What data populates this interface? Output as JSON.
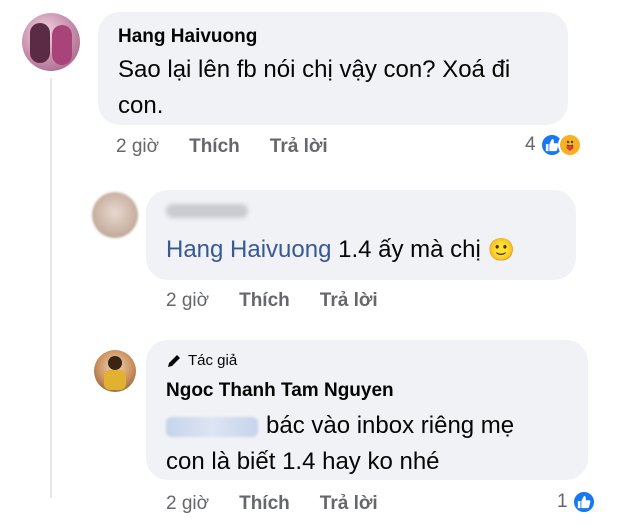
{
  "comments": [
    {
      "author": "Hang Haivuong",
      "text_line1": "Sao lại lên fb nói chị vậy con? Xoá đi",
      "text_line2": "con.",
      "time": "2 giờ",
      "like": "Thích",
      "reply": "Trả lời",
      "reaction_count": "4",
      "reactions": [
        "like-icon",
        "care-icon"
      ]
    },
    {
      "author": "",
      "mention": "Hang Haivuong",
      "text": " 1.4 ấy mà chị ",
      "emoji": "🙂",
      "time": "2 giờ",
      "like": "Thích",
      "reply": "Trả lời"
    },
    {
      "badge": "Tác giả",
      "author": "Ngoc Thanh Tam Nguyen",
      "text_line1": "bác vào inbox riêng mẹ",
      "text_line2": "con là biết 1.4 hay ko nhé",
      "time": "2 giờ",
      "like": "Thích",
      "reply": "Trả lời",
      "reaction_count": "1",
      "reactions": [
        "like-icon"
      ]
    }
  ],
  "colors": {
    "bubble": "#f0f2f5",
    "meta": "#65676b",
    "mention": "#385898",
    "like_blue": "#1877f2",
    "care_yellow": "#f7b125"
  }
}
